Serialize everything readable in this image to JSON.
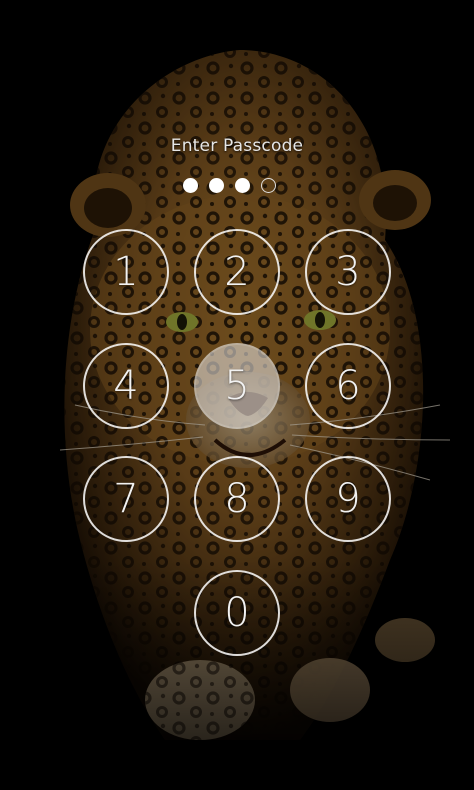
{
  "lockscreen": {
    "title": "Enter Passcode",
    "passcode_length": 4,
    "entered_count": 3,
    "pressed_key": "5",
    "keys": [
      "1",
      "2",
      "3",
      "4",
      "5",
      "6",
      "7",
      "8",
      "9",
      "0"
    ]
  },
  "wallpaper": {
    "icon": "leopard-wallpaper"
  },
  "colors": {
    "background": "#000000",
    "ring": "#ffffff",
    "pressed_fill": "#d8d4cf"
  }
}
